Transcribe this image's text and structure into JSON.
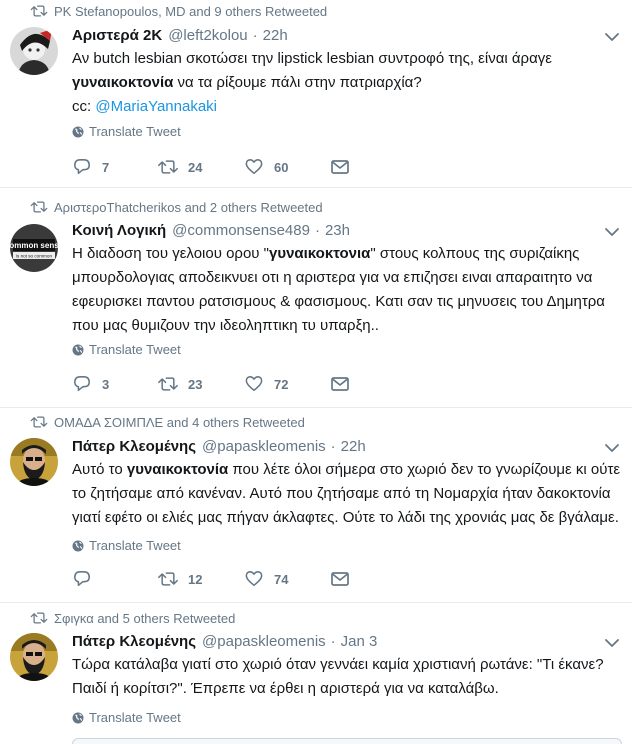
{
  "icons": {
    "retweet": "retweet-icon",
    "reply": "reply-icon",
    "like": "heart-icon",
    "dm": "envelope-icon",
    "translate": "globe-icon",
    "more": "chevron-down-icon"
  },
  "colors": {
    "link": "#1b95e0",
    "muted": "#657786",
    "text": "#14171a"
  },
  "translate_label": "Translate Tweet",
  "tweets": [
    {
      "retweeted_by": "PK Stefanopoulos, MD and 9 others Retweeted",
      "name": "Αριστερά 2Κ",
      "handle": "@left2kolou",
      "time": "22h",
      "text_1": "Αν butch lesbian σκοτώσει την lipstick lesbian συντροφό της, είναι άραγε",
      "text_2_bold": "γυναικοκτονία",
      "text_2_rest": " να τα ρίξουμε πάλι στην πατριαρχία?",
      "text_3_prefix": "cc: ",
      "text_3_mention": "@MariaYannakaki",
      "replies": "7",
      "retweets": "24",
      "likes": "60"
    },
    {
      "retweeted_by": "ΑριστεροThatcherikos and 2 others Retweeted",
      "name": "Κοινή Λογική",
      "handle": "@commonsense489",
      "time": "23h",
      "text_a": "Η διαδοση του γελοιου ορου \"",
      "text_bold": "γυναικοκτονια",
      "text_b": "\" στους κολπους της συριζαίκης μπουρδολογιας αποδεικνυει οτι η αριστερα για να επιζησει ειναι απαραιτητο να εφευρισκει παντου ρατσισμους & φασισμους. Κατι σαν τις μηνυσεις του Δημητρα που μας θυμιζουν την ιδεοληπτικη τυ υπαρξη..",
      "avatar_text_1": "common sense",
      "avatar_text_2": "is not so common",
      "replies": "3",
      "retweets": "23",
      "likes": "72"
    },
    {
      "retweeted_by": "ΟΜΑΔΑ ΣΟΙΜΠΛΕ and 4 others Retweeted",
      "name": "Πάτερ Κλεομένης",
      "handle": "@papaskleomenis",
      "time": "22h",
      "text_a": "Αυτό το ",
      "text_bold": "γυναικοκτονία",
      "text_b": " που λέτε όλοι σήμερα στο χωριό δεν το γνωρίζουμε κι ούτε το ζητήσαμε από κανέναν. Αυτό που ζητήσαμε από τη Νομαρχία ήταν δακοκτονία γιατί εφέτο οι ελιές μας πήγαν άκλαφτες. Ούτε το λάδι της χρονιάς μας δε βγάλαμε.",
      "replies": "",
      "retweets": "12",
      "likes": "74"
    },
    {
      "retweeted_by": "Σφιγκα and 5 others Retweeted",
      "name": "Πάτερ Κλεομένης",
      "handle": "@papaskleomenis",
      "time": "Jan 3",
      "text": "Τώρα κατάλαβα γιατί στο χωριό όταν γεννάει καμία χριστιανή ρωτάνε: \"Τι έκανε? Παιδί ή κορίτσι?\". Έπρεπε να έρθει η αριστερά για να καταλάβω."
    }
  ]
}
